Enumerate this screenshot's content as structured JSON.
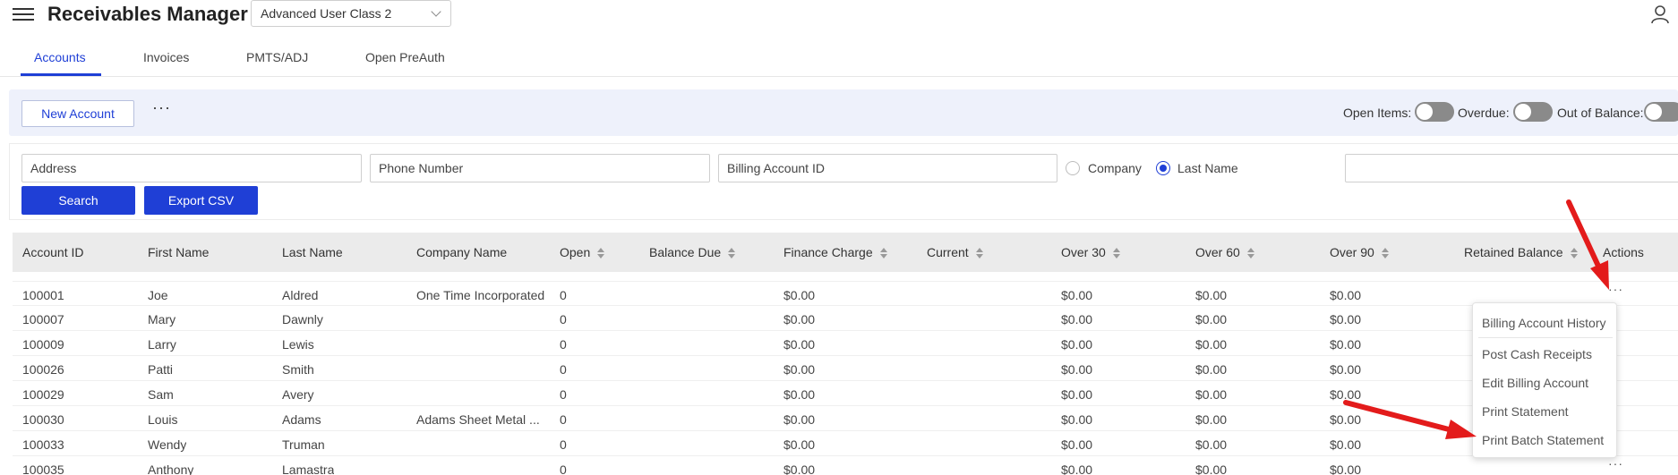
{
  "header": {
    "app_title": "Receivables Manager",
    "user_class": "Advanced User Class 2"
  },
  "tabs": [
    {
      "label": "Accounts",
      "active": true
    },
    {
      "label": "Invoices",
      "active": false
    },
    {
      "label": "PMTS/ADJ",
      "active": false
    },
    {
      "label": "Open PreAuth",
      "active": false
    }
  ],
  "toolbar": {
    "new_account_label": "New Account",
    "more_label": "···",
    "toggles": [
      {
        "label": "Open Items:",
        "on": false
      },
      {
        "label": "Overdue:",
        "on": false
      },
      {
        "label": "Out of Balance:",
        "on": false
      }
    ]
  },
  "filters": {
    "address_placeholder": "Address",
    "phone_placeholder": "Phone Number",
    "billing_id_placeholder": "Billing Account ID",
    "radio_company": "Company",
    "radio_last_name": "Last Name",
    "selected_radio": "Last Name",
    "search_label": "Search",
    "export_label": "Export CSV"
  },
  "table": {
    "columns": [
      "Account ID",
      "First Name",
      "Last Name",
      "Company Name",
      "Open",
      "Balance Due",
      "Finance Charge",
      "Current",
      "Over 30",
      "Over 60",
      "Over 90",
      "Retained Balance",
      "Actions"
    ],
    "rows": [
      [
        "100001",
        "Joe",
        "Aldred",
        "One Time Incorporated",
        "0",
        "",
        "$0.00",
        "",
        "$0.00",
        "$0.00",
        "$0.00",
        "",
        ""
      ],
      [
        "100007",
        "Mary",
        "Dawnly",
        "",
        "0",
        "",
        "$0.00",
        "",
        "$0.00",
        "$0.00",
        "$0.00",
        "",
        ""
      ],
      [
        "100009",
        "Larry",
        "Lewis",
        "",
        "0",
        "",
        "$0.00",
        "",
        "$0.00",
        "$0.00",
        "$0.00",
        "",
        ""
      ],
      [
        "100026",
        "Patti",
        "Smith",
        "",
        "0",
        "",
        "$0.00",
        "",
        "$0.00",
        "$0.00",
        "$0.00",
        "",
        ""
      ],
      [
        "100029",
        "Sam",
        "Avery",
        "",
        "0",
        "",
        "$0.00",
        "",
        "$0.00",
        "$0.00",
        "$0.00",
        "",
        ""
      ],
      [
        "100030",
        "Louis",
        "Adams",
        "Adams Sheet Metal ...",
        "0",
        "",
        "$0.00",
        "",
        "$0.00",
        "$0.00",
        "$0.00",
        "",
        ""
      ],
      [
        "100033",
        "Wendy",
        "Truman",
        "",
        "0",
        "",
        "$0.00",
        "",
        "$0.00",
        "$0.00",
        "$0.00",
        "",
        ""
      ],
      [
        "100035",
        "Anthony",
        "Lamastra",
        "",
        "0",
        "",
        "$0.00",
        "",
        "$0.00",
        "$0.00",
        "$0.00",
        "",
        ""
      ]
    ],
    "row_actions_label": "···"
  },
  "actions_menu": {
    "items": [
      "Billing Account History",
      "Post Cash Receipts",
      "Edit Billing Account",
      "Print Statement",
      "Print Batch Statement"
    ]
  },
  "colors": {
    "accent": "#1f3fd6",
    "toolbar_bg": "#eef1fb",
    "annotation_arrow": "#e31b1b"
  },
  "icons": {
    "menu": "hamburger-icon",
    "user": "user-icon",
    "dropdown": "chevron-down-icon",
    "sort": "sort-icon"
  }
}
